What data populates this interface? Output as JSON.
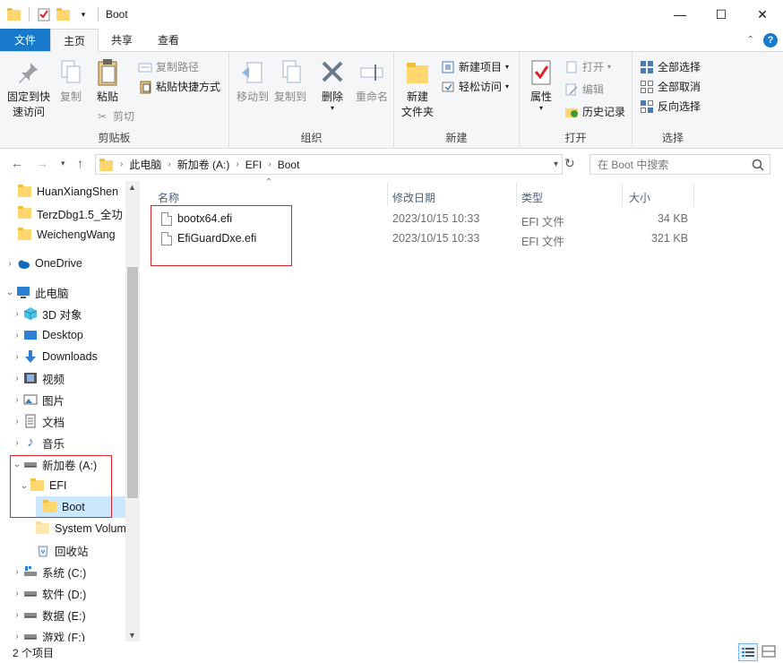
{
  "window": {
    "title": "Boot",
    "minimize": "—",
    "maximize": "☐",
    "close": "✕"
  },
  "tabs": [
    "文件",
    "主页",
    "共享",
    "查看"
  ],
  "ribbon": {
    "clipboard": {
      "label": "剪贴板",
      "pin": "固定到快\n速访问",
      "pin_l1": "固定到快",
      "pin_l2": "速访问",
      "copy": "复制",
      "paste": "粘贴",
      "copy_path": "复制路径",
      "paste_shortcut": "粘贴快捷方式",
      "cut": "剪切"
    },
    "organize": {
      "label": "组织",
      "move_to": "移动到",
      "copy_to": "复制到",
      "delete": "删除",
      "rename": "重命名"
    },
    "new": {
      "label": "新建",
      "new_folder_l1": "新建",
      "new_folder_l2": "文件夹",
      "new_item": "新建项目",
      "easy_access": "轻松访问"
    },
    "open": {
      "label": "打开",
      "properties": "属性",
      "open": "打开",
      "edit": "编辑",
      "history": "历史记录"
    },
    "select": {
      "label": "选择",
      "select_all": "全部选择",
      "select_none": "全部取消",
      "invert": "反向选择"
    }
  },
  "address": {
    "crumbs": [
      "此电脑",
      "新加卷 (A:)",
      "EFI",
      "Boot"
    ],
    "search_placeholder": "在 Boot 中搜索"
  },
  "nav": {
    "items": [
      {
        "label": "HuanXiangShen"
      },
      {
        "label": "TerzDbg1.5_全功"
      },
      {
        "label": "WeichengWang"
      },
      {
        "label": "OneDrive"
      },
      {
        "label": "此电脑"
      },
      {
        "label": "3D 对象"
      },
      {
        "label": "Desktop"
      },
      {
        "label": "Downloads"
      },
      {
        "label": "视频"
      },
      {
        "label": "图片"
      },
      {
        "label": "文档"
      },
      {
        "label": "音乐"
      },
      {
        "label": "新加卷 (A:)"
      },
      {
        "label": "EFI"
      },
      {
        "label": "Boot"
      },
      {
        "label": "System Volum"
      },
      {
        "label": "回收站"
      },
      {
        "label": "系统 (C:)"
      },
      {
        "label": "软件 (D:)"
      },
      {
        "label": "数据 (E:)"
      },
      {
        "label": "游戏 (F:)"
      }
    ]
  },
  "columns": {
    "name": "名称",
    "modified": "修改日期",
    "type": "类型",
    "size": "大小"
  },
  "files": [
    {
      "name": "bootx64.efi",
      "modified": "2023/10/15 10:33",
      "type": "EFI 文件",
      "size": "34 KB"
    },
    {
      "name": "EfiGuardDxe.efi",
      "modified": "2023/10/15 10:33",
      "type": "EFI 文件",
      "size": "321 KB"
    }
  ],
  "status": {
    "count": "2 个项目"
  },
  "colors": {
    "accent": "#1979ca",
    "highlight_box": "#d9262b",
    "selection": "#cce8ff"
  }
}
